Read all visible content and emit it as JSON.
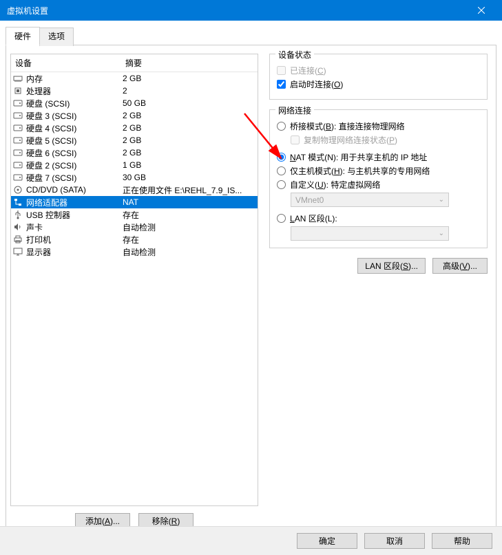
{
  "title": "虚拟机设置",
  "tabs": {
    "hardware": "硬件",
    "options": "选项"
  },
  "headers": {
    "device": "设备",
    "summary": "摘要"
  },
  "devices": [
    {
      "icon": "memory",
      "name": "内存",
      "summary": "2 GB"
    },
    {
      "icon": "cpu",
      "name": "处理器",
      "summary": "2"
    },
    {
      "icon": "disk",
      "name": "硬盘 (SCSI)",
      "summary": "50 GB"
    },
    {
      "icon": "disk",
      "name": "硬盘 3 (SCSI)",
      "summary": "2 GB"
    },
    {
      "icon": "disk",
      "name": "硬盘 4 (SCSI)",
      "summary": "2 GB"
    },
    {
      "icon": "disk",
      "name": "硬盘 5 (SCSI)",
      "summary": "2 GB"
    },
    {
      "icon": "disk",
      "name": "硬盘 6 (SCSI)",
      "summary": "2 GB"
    },
    {
      "icon": "disk",
      "name": "硬盘 2 (SCSI)",
      "summary": "1 GB"
    },
    {
      "icon": "disk",
      "name": "硬盘 7 (SCSI)",
      "summary": "30 GB"
    },
    {
      "icon": "cd",
      "name": "CD/DVD (SATA)",
      "summary": "正在使用文件 E:\\REHL_7.9_IS..."
    },
    {
      "icon": "net",
      "name": "网络适配器",
      "summary": "NAT",
      "selected": true
    },
    {
      "icon": "usb",
      "name": "USB 控制器",
      "summary": "存在"
    },
    {
      "icon": "sound",
      "name": "声卡",
      "summary": "自动检测"
    },
    {
      "icon": "printer",
      "name": "打印机",
      "summary": "存在"
    },
    {
      "icon": "display",
      "name": "显示器",
      "summary": "自动检测"
    }
  ],
  "buttons": {
    "add": "添加(A)...",
    "remove": "移除(R)",
    "lan": "LAN 区段(S)...",
    "advanced": "高级(V)...",
    "ok": "确定",
    "cancel": "取消",
    "help": "帮助"
  },
  "status_group": {
    "title": "设备状态",
    "connected": "已连接(C)",
    "connect_on_poweron": "启动时连接(O)"
  },
  "network_group": {
    "title": "网络连接",
    "bridged": "桥接模式(B): 直接连接物理网络",
    "replicate": "复制物理网络连接状态(P)",
    "nat": "NAT 模式(N): 用于共享主机的 IP 地址",
    "hostonly": "仅主机模式(H): 与主机共享的专用网络",
    "custom": "自定义(U): 特定虚拟网络",
    "custom_value": "VMnet0",
    "lanseg": "LAN 区段(L):",
    "lanseg_value": ""
  }
}
